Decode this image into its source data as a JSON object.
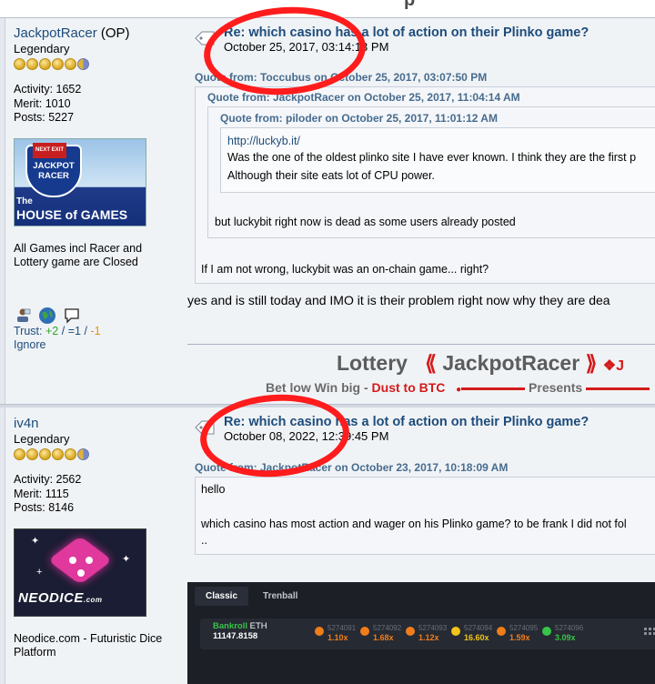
{
  "top_fragment": "p",
  "posts": [
    {
      "username": "JackpotRacer",
      "op_label": "(OP)",
      "rank": "Legendary",
      "activity": "Activity: 1652",
      "merit": "Merit: 1010",
      "posts": "Posts: 5227",
      "avatar": {
        "next_exit": "NEXT EXIT",
        "shield_l1": "JACKPOT",
        "shield_l2": "RACER",
        "the": "The",
        "house": "HOUSE of GAMES"
      },
      "personal_text_1": "All Games incl Racer and",
      "personal_text_2": "Lottery game are Closed",
      "trust": {
        "label": "Trust:",
        "pos": "+2",
        "sep1": "/",
        "neutral": "=1",
        "sep2": "/",
        "neg": "-1"
      },
      "ignore": "Ignore",
      "subject": "Re: which casino has a lot of action on their Plinko game?",
      "date": "October 25, 2017, 03:14:13 PM",
      "quotes": [
        {
          "header": "Quote from: Toccubus on October 25, 2017, 03:07:50 PM"
        },
        {
          "header": "Quote from: JackpotRacer on October 25, 2017, 11:04:14 AM"
        },
        {
          "header": "Quote from: piloder on October 25, 2017, 11:01:12 AM"
        }
      ],
      "inner_link": "http://luckyb.it/",
      "inner_line1": "Was the one of the oldest plinko site I have ever known. I think they are the first p",
      "inner_line2": "Although their site eats lot of CPU power.",
      "mid_quote_text": "but luckybit right now is dead as some users already posted",
      "outer_quote_text": "If I am not wrong, luckybit was an on-chain game... right?",
      "body": "yes and is still today and IMO it is their problem right now why they are dea",
      "signature": {
        "lottery": "Lottery",
        "open_bracket": "⟪",
        "name": "JackpotRacer",
        "close_bracket": "⟫",
        "tail": "❖J",
        "bet_prefix": "Bet low Win big - ",
        "bet_red": "Dust to BTC",
        "presents": "Presents"
      }
    },
    {
      "username": "iv4n",
      "rank": "Legendary",
      "activity": "Activity: 2562",
      "merit": "Merit: 1115",
      "posts": "Posts: 8146",
      "avatar": {
        "brand": "NEODICE",
        "brand_suffix": ".com"
      },
      "personal_text_1": "Neodice.com - Futuristic Dice",
      "personal_text_2": "Platform",
      "subject": "Re: which casino has a lot of action on their Plinko game?",
      "date": "October 08, 2022, 12:39:45 PM",
      "quotes": [
        {
          "header": "Quote from: JackpotRacer on October 23, 2017, 10:18:09 AM"
        }
      ],
      "quote_line1": "hello",
      "quote_line2": "which casino has most action and wager on his Plinko game? to be frank I did not fol",
      "quote_line3": "..",
      "game": {
        "tab1": "Classic",
        "tab2": "Trenball",
        "bankroll_label": "Bankroll",
        "currency": "ETH",
        "bankroll_value": "11147.8158",
        "rounds": [
          {
            "id": "5274091",
            "mult": "1.10x",
            "color": "#f07d1a"
          },
          {
            "id": "5274092",
            "mult": "1.68x",
            "color": "#f07d1a"
          },
          {
            "id": "5274093",
            "mult": "1.12x",
            "color": "#f07d1a"
          },
          {
            "id": "5274094",
            "mult": "16.60x",
            "color": "#f0c419"
          },
          {
            "id": "5274095",
            "mult": "1.59x",
            "color": "#f07d1a"
          },
          {
            "id": "5274096",
            "mult": "3.09x",
            "color": "#39c44a"
          }
        ]
      }
    }
  ],
  "colors": {
    "link": "#1d4c7b",
    "annotation_circle": "#ff1c1c",
    "accent_red": "#d31b1b"
  }
}
